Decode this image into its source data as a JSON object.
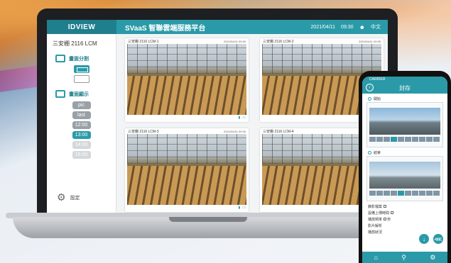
{
  "laptop": {
    "brand": "IDVIEW",
    "app_title": "SVaaS 智聯雲端服務平台",
    "date": "2021/04/11",
    "time": "09:30",
    "lang": "中文",
    "device_name": "三安棚 2116 LCM",
    "sections": {
      "layout_label": "畫面分割",
      "display_label": "畫面顯示",
      "settings_label": "設定"
    },
    "display_options": [
      "pic",
      "last",
      "12:00",
      "13:00",
      "14:00",
      "15:00"
    ],
    "cameras": [
      {
        "label": "三安棚 2116 LCM-1",
        "timestamp": "2021/04/11 09:30"
      },
      {
        "label": "三安棚 2116 LCM-2",
        "timestamp": "2021/04/11 09:30"
      },
      {
        "label": "三安棚 2116 LCM-3",
        "timestamp": "2021/04/11 09:30"
      },
      {
        "label": "三安棚 2116 LCM-4",
        "timestamp": "2021/04/11 09:30"
      }
    ]
  },
  "phone": {
    "carrier": "CARRIER",
    "title": "封存",
    "sections": [
      "開始",
      "結束"
    ],
    "form": {
      "field1": "錄影檔案",
      "field2": "設備上傳時間",
      "field3": "播放頻率",
      "field3_option": "秒",
      "field4": "影片解析",
      "field5": "播放狀況"
    }
  },
  "colors": {
    "accent": "#2b9aa8",
    "accent_dark": "#1f7f8c"
  }
}
